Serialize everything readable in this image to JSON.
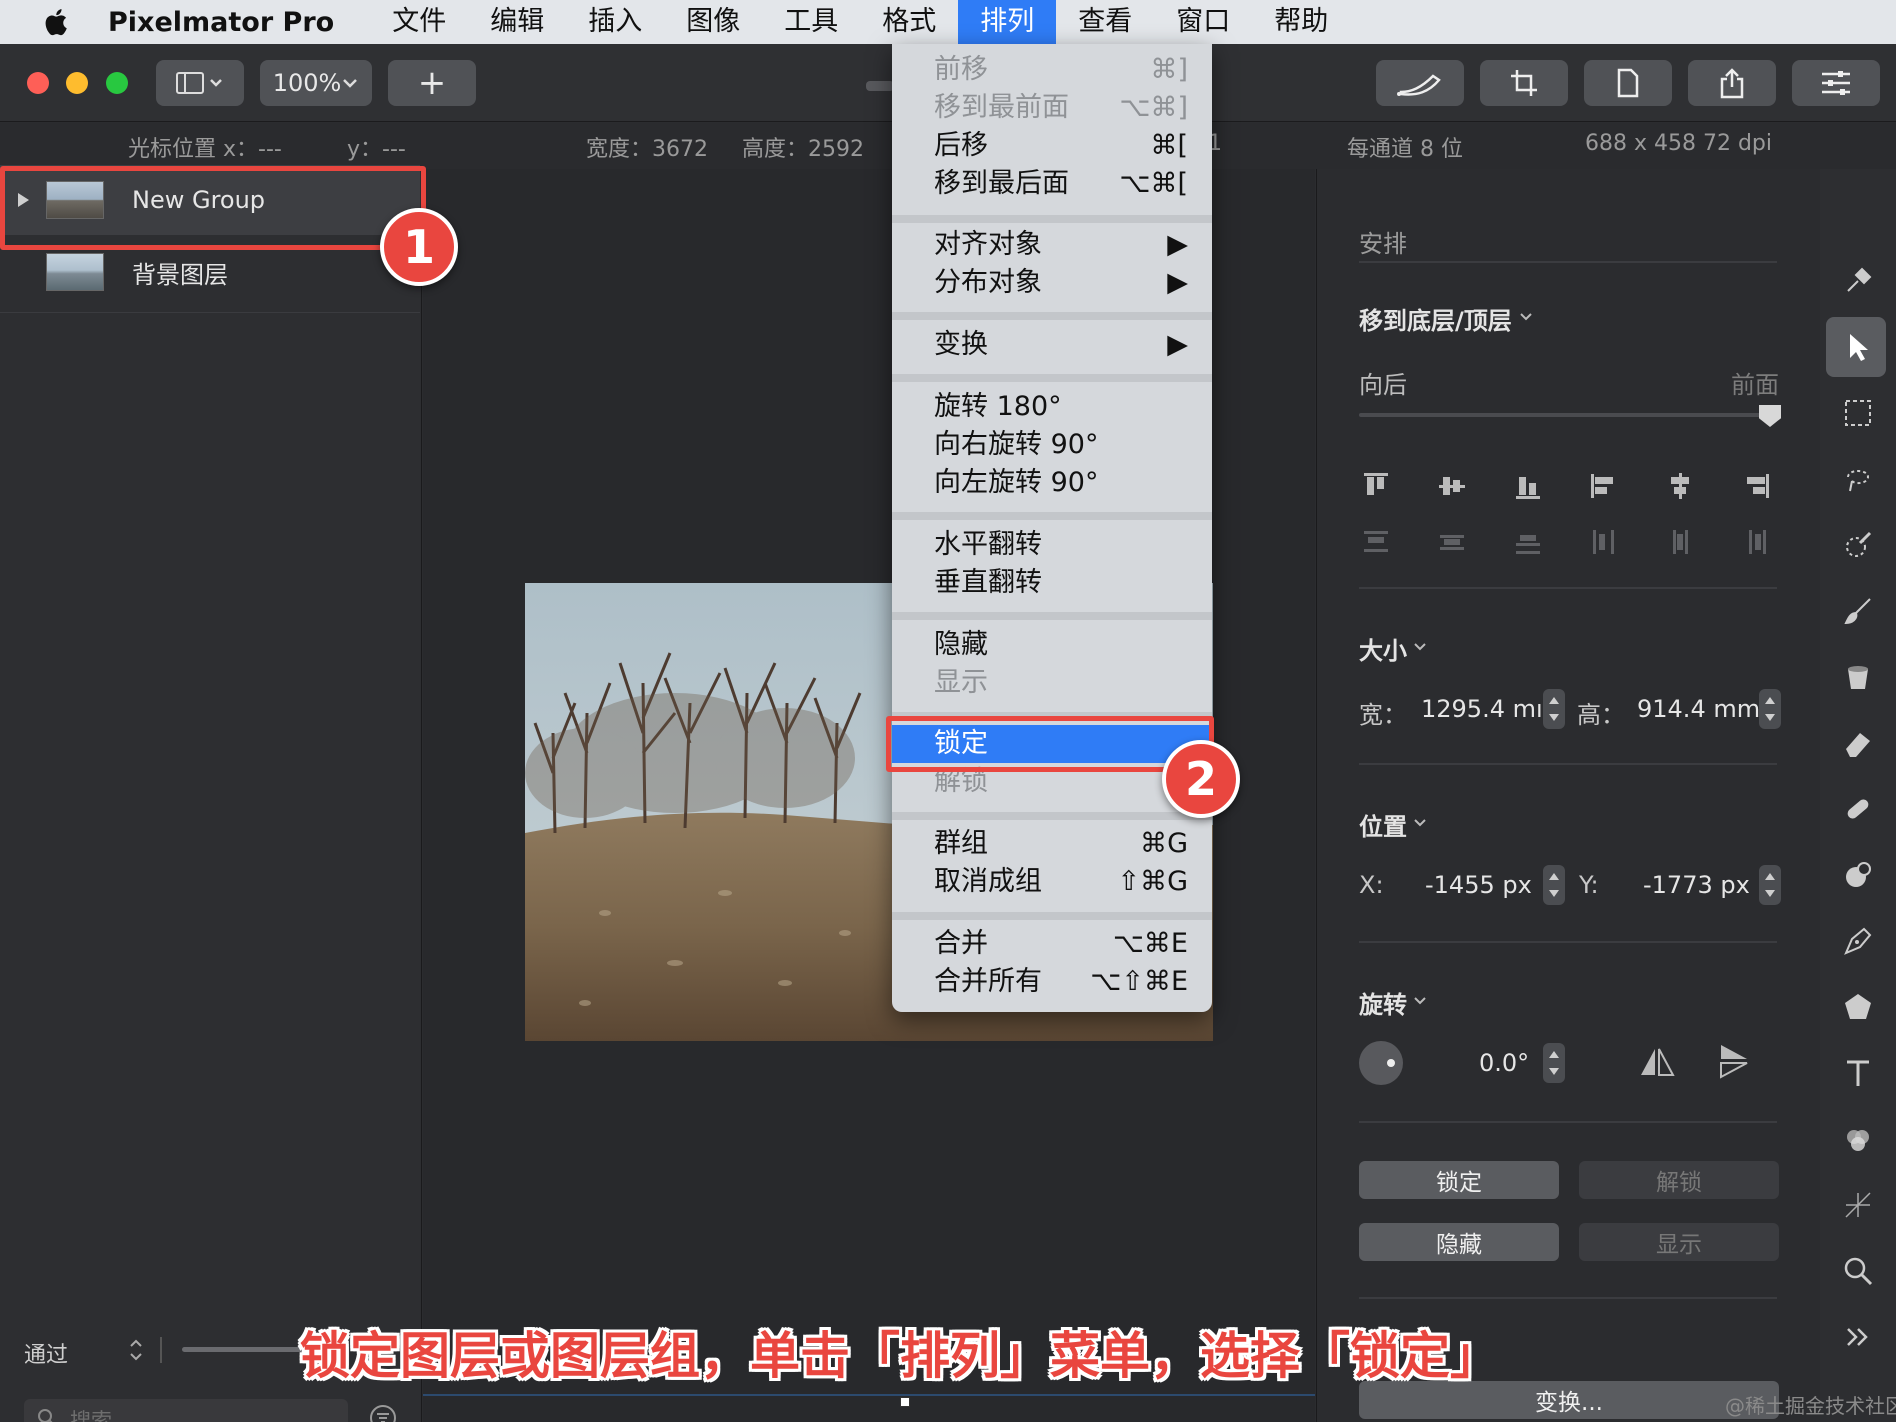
{
  "menubar": {
    "app_name": "Pixelmator Pro",
    "items": [
      "文件",
      "编辑",
      "插入",
      "图像",
      "工具",
      "格式",
      "排列",
      "查看",
      "窗口",
      "帮助"
    ],
    "active_item": "排列"
  },
  "toolbar": {
    "zoom_label": "100%",
    "add_label": "+"
  },
  "infobar": {
    "cursor_x": "光标位置 x：---",
    "cursor_y": "y：---",
    "width": "宽度：3672",
    "height": "高度：2592",
    "partial": "1",
    "bits": "每通道 8 位",
    "dpi": "688 x 458 72 dpi"
  },
  "layers": {
    "items": [
      {
        "name": "New Group",
        "selected": true
      },
      {
        "name": "背景图层",
        "selected": false
      }
    ],
    "blend_mode": "通过",
    "search_placeholder": "搜索"
  },
  "menu": {
    "items": [
      {
        "label": "前移",
        "shortcut": "⌘]",
        "enabled": false
      },
      {
        "label": "移到最前面",
        "shortcut": "⌥⌘]",
        "enabled": false
      },
      {
        "label": "后移",
        "shortcut": "⌘[",
        "enabled": true
      },
      {
        "label": "移到最后面",
        "shortcut": "⌥⌘[",
        "enabled": true
      },
      {
        "label": "对齐对象",
        "shortcut": "▶",
        "enabled": true
      },
      {
        "label": "分布对象",
        "shortcut": "▶",
        "enabled": true
      },
      {
        "label": "变换",
        "shortcut": "▶",
        "enabled": true
      },
      {
        "label": "旋转 180°",
        "shortcut": "",
        "enabled": true
      },
      {
        "label": "向右旋转 90°",
        "shortcut": "",
        "enabled": true
      },
      {
        "label": "向左旋转 90°",
        "shortcut": "",
        "enabled": true
      },
      {
        "label": "水平翻转",
        "shortcut": "",
        "enabled": true
      },
      {
        "label": "垂直翻转",
        "shortcut": "",
        "enabled": true
      },
      {
        "label": "隐藏",
        "shortcut": "",
        "enabled": true
      },
      {
        "label": "显示",
        "shortcut": "",
        "enabled": false
      },
      {
        "label": "锁定",
        "shortcut": "",
        "enabled": true,
        "highlighted": true
      },
      {
        "label": "解锁",
        "shortcut": "",
        "enabled": false
      },
      {
        "label": "群组",
        "shortcut": "⌘G",
        "enabled": true
      },
      {
        "label": "取消成组",
        "shortcut": "⇧⌘G",
        "enabled": true
      },
      {
        "label": "合并",
        "shortcut": "⌥⌘E",
        "enabled": true
      },
      {
        "label": "合并所有",
        "shortcut": "⌥⇧⌘E",
        "enabled": true
      }
    ]
  },
  "panel": {
    "title": "安排",
    "order_heading": "移到底层/顶层",
    "back_label": "向后",
    "front_label": "前面",
    "size_heading": "大小",
    "width_label": "宽：",
    "width_value": "1295.4 mı",
    "height_label": "高：",
    "height_value": "914.4 mm",
    "position_heading": "位置",
    "x_label": "X:",
    "x_value": "-1455 px",
    "y_label": "Y:",
    "y_value": "-1773 px",
    "rotate_heading": "旋转",
    "rotate_value": "0.0°",
    "lock_button": "锁定",
    "unlock_button": "解锁",
    "hide_button": "隐藏",
    "show_button": "显示",
    "transform_button": "变换..."
  },
  "annotations": {
    "badge1": "1",
    "badge2": "2",
    "caption": "锁定图层或图层组，单击「排列」菜单，选择「锁定」",
    "watermark": "@稀土掘金技术社区"
  },
  "colors": {
    "accent": "#2f7cf6",
    "annotation_red": "#e9463f",
    "traffic_red": "#fe5f57",
    "traffic_yellow": "#febc2e",
    "traffic_green": "#28c840"
  }
}
